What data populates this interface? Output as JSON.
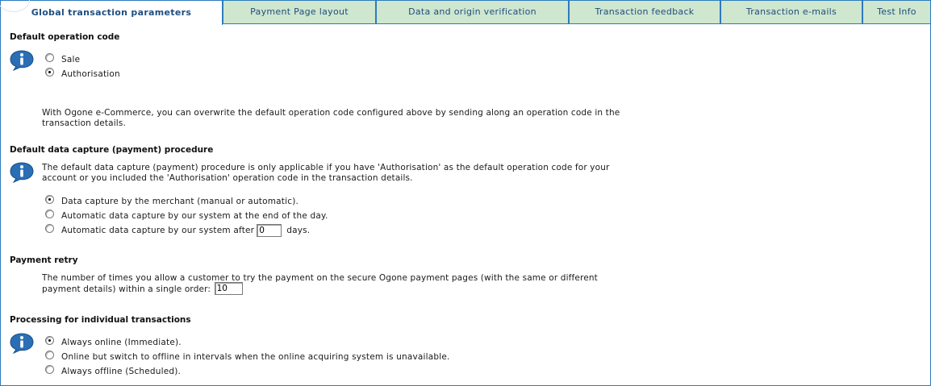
{
  "tabs": [
    {
      "label": "Global transaction parameters",
      "active": true
    },
    {
      "label": "Payment Page layout",
      "active": false
    },
    {
      "label": "Data and origin verification",
      "active": false
    },
    {
      "label": "Transaction feedback",
      "active": false
    },
    {
      "label": "Transaction e-mails",
      "active": false
    },
    {
      "label": "Test Info",
      "active": false
    }
  ],
  "sections": {
    "default_operation": {
      "heading": "Default operation code",
      "options": [
        {
          "label": "Sale",
          "checked": false
        },
        {
          "label": "Authorisation",
          "checked": true
        }
      ],
      "note": "With Ogone e-Commerce, you can overwrite the default operation code configured above by sending along an operation code in the transaction details."
    },
    "data_capture": {
      "heading": "Default data capture (payment) procedure",
      "note": "The default data capture (payment) procedure is only applicable if you have 'Authorisation' as the default operation code for your account or you included the 'Authorisation' operation code in the transaction details.",
      "options": [
        {
          "label": "Data capture by the merchant (manual or automatic).",
          "checked": true
        },
        {
          "label": "Automatic data capture by our system at the end of the day.",
          "checked": false
        },
        {
          "label_before": "Automatic data capture by our system after",
          "label_after": "days.",
          "value": "0",
          "checked": false
        }
      ]
    },
    "payment_retry": {
      "heading": "Payment retry",
      "note": "The number of times you allow a customer to try the payment on the secure Ogone payment pages (with the same or different payment details) within a single order:",
      "value": "10"
    },
    "processing": {
      "heading": "Processing for individual transactions",
      "options": [
        {
          "label": "Always online (Immediate).",
          "checked": true
        },
        {
          "label": "Online but switch to offline in intervals when the online acquiring system is unavailable.",
          "checked": false
        },
        {
          "label": "Always offline (Scheduled).",
          "checked": false
        }
      ]
    }
  },
  "icons": {
    "info": "info-icon"
  },
  "colors": {
    "tab_bg": "#cfe6cf",
    "tab_text": "#1d4e80",
    "border": "#2e7bbd",
    "icon_blue": "#2a6fb5"
  }
}
